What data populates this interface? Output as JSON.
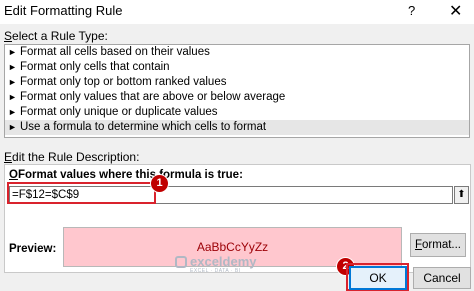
{
  "window": {
    "title": "Edit Formatting Rule",
    "help_glyph": "?",
    "close_glyph": "✕"
  },
  "rule_type": {
    "label_accel": "S",
    "label_rest": "elect a Rule Type:",
    "items": [
      "Format all cells based on their values",
      "Format only cells that contain",
      "Format only top or bottom ranked values",
      "Format only values that are above or below average",
      "Format only unique or duplicate values",
      "Use a formula to determine which cells to format"
    ],
    "selected_index": 5,
    "bullet_glyph": "►"
  },
  "description": {
    "label_accel": "E",
    "label_rest": "dit the Rule Description:",
    "formula_heading_accel": "O",
    "formula_heading_rest": "Format values where this formula is true:",
    "formula_value": "=F$12=$C$9",
    "collapse_glyph": "⬆",
    "preview_label": "Preview:",
    "preview_text": "AaBbCcYyZz",
    "format_button_accel": "F",
    "format_button_rest": "ormat..."
  },
  "buttons": {
    "ok": "OK",
    "cancel": "Cancel"
  },
  "callouts": [
    "1",
    "2"
  ],
  "watermark": {
    "name": "exceldemy",
    "tagline": "EXCEL · DATA · BI"
  },
  "colors": {
    "highlight_border": "#d9232d",
    "badge_fill": "#c00000",
    "preview_fill": "#ffc7ce",
    "preview_text": "#9c0006",
    "ok_border": "#0078d7"
  }
}
